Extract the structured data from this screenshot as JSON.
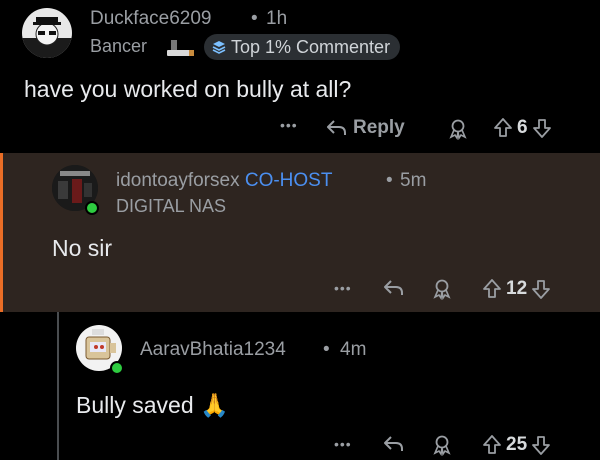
{
  "comment1": {
    "username": "Duckface6209",
    "separator": "•",
    "time": "1h",
    "flair": "Bancer",
    "badge_label": "Top 1% Commenter",
    "text": "have you worked on bully at all?",
    "more_label": "•••",
    "reply_label": "Reply",
    "vote_count": "6"
  },
  "comment2": {
    "username": "idontoayforsex",
    "role": "CO-HOST",
    "separator": "•",
    "time": "5m",
    "flair": "DIGITAL NAS",
    "text": "No sir",
    "more_label": "•••",
    "vote_count": "12"
  },
  "comment3": {
    "username": "AaravBhatia1234",
    "separator": "•",
    "time": "4m",
    "text": "Bully saved",
    "emoji": "🙏",
    "more_label": "•••",
    "vote_count": "25"
  },
  "colors": {
    "background": "#000000",
    "highlight": "#2e2520",
    "accent": "#e96d26",
    "cohost": "#4b8ff0",
    "online": "#2ecc40"
  },
  "icons": [
    "more-icon",
    "reply-arrow-icon",
    "award-icon",
    "upvote-icon",
    "downvote-icon",
    "pray-emoji"
  ]
}
